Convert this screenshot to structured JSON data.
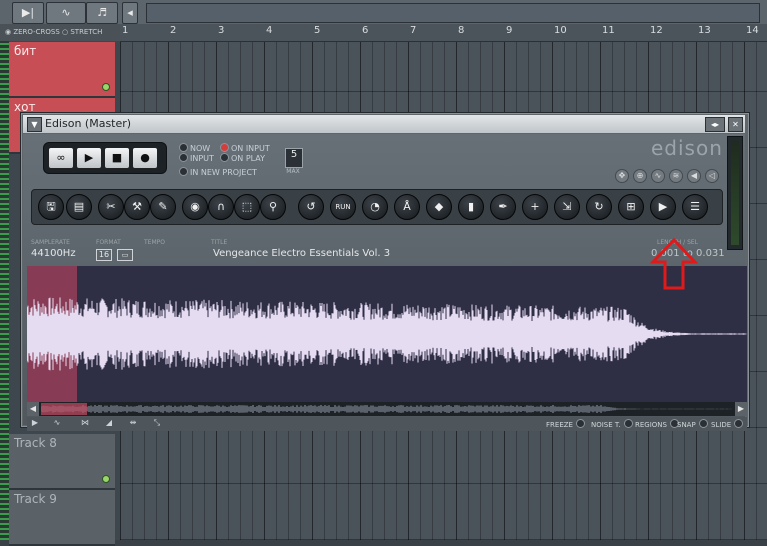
{
  "playlist": {
    "toolbar_buttons": [
      "▶|",
      "∿",
      "♬",
      "◂"
    ],
    "options": [
      "ZERO-CROSS",
      "STRETCH"
    ],
    "ruler": [
      "1",
      "2",
      "3",
      "4",
      "5",
      "6",
      "7",
      "8",
      "9",
      "10",
      "11",
      "12",
      "13",
      "14"
    ],
    "tracks": [
      {
        "name": "бит",
        "color": "#c84e55"
      },
      {
        "name": "хот",
        "color": "#c84e55"
      },
      {
        "name": "Track 8",
        "color": "#5a6267"
      },
      {
        "name": "Track 9",
        "color": "#5a6267"
      }
    ]
  },
  "edison": {
    "title": "Edison (Master)",
    "logo": "edison",
    "transport": {
      "loop": "∞",
      "play": "▶",
      "stop": "■",
      "record": "●"
    },
    "record_options": {
      "now": "NOW",
      "input": "INPUT",
      "on_input": "ON INPUT",
      "on_play": "ON PLAY",
      "in_new_project": "IN NEW PROJECT"
    },
    "max": {
      "value": "5",
      "label": "MAX"
    },
    "info": {
      "samplerate_label": "SAMPLERATE",
      "samplerate": "44100Hz",
      "format_label": "FORMAT",
      "format_bits": "16",
      "tempo_label": "TEMPO",
      "title_label": "TITLE",
      "title": "Vengeance Electro Essentials Vol. 3",
      "length_label": "LENGTH / SEL",
      "length": "0.001 to 0.031"
    },
    "bottom_options": [
      "FREEZE",
      "NOISE T.",
      "REGIONS",
      "SNAP",
      "SLIDE"
    ]
  },
  "colors": {
    "waveform_bg": "#2e2e45",
    "waveform": "#e6dcf2",
    "selection": "#ff6f8a",
    "annotation_arrow": "#e01a1a"
  }
}
